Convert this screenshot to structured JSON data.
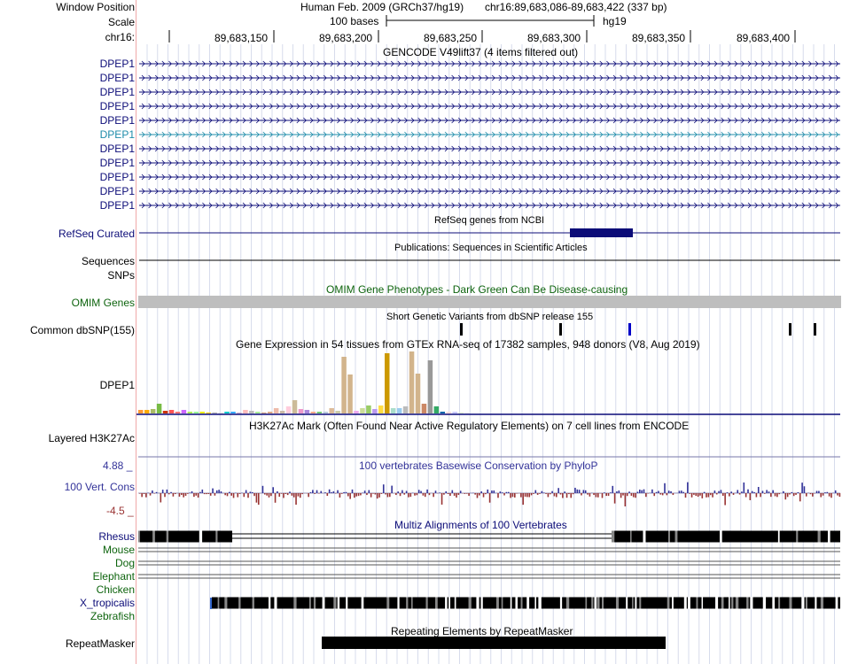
{
  "header": {
    "window_position_label": "Window Position",
    "scale_label": "Scale",
    "chrom_label": "chr16:",
    "assembly": "Human Feb. 2009 (GRCh37/hg19)",
    "position": "chr16:89,683,086-89,683,422 (337 bp)",
    "scale_text": "100 bases",
    "db": "hg19",
    "ticks": [
      "89,683,150",
      "89,683,200",
      "89,683,250",
      "89,683,300",
      "89,683,350",
      "89,683,400"
    ]
  },
  "gencode": {
    "title": "GENCODE V49lift37 (4 items filtered out)",
    "items": [
      "DPEP1",
      "DPEP1",
      "DPEP1",
      "DPEP1",
      "DPEP1",
      "DPEP1",
      "DPEP1",
      "DPEP1",
      "DPEP1",
      "DPEP1",
      "DPEP1"
    ],
    "colors": [
      "#0c0c78",
      "#0c0c78",
      "#0c0c78",
      "#0c0c78",
      "#0c0c78",
      "#1e8caa",
      "#0c0c78",
      "#0c0c78",
      "#0c0c78",
      "#0c0c78",
      "#0c0c78"
    ]
  },
  "refseq": {
    "title": "RefSeq genes from NCBI",
    "label": "RefSeq Curated",
    "color": "#0c0c78"
  },
  "pubs": {
    "title": "Publications: Sequences in Scientific Articles",
    "label": "Sequences"
  },
  "snps": {
    "label": "SNPs"
  },
  "omim": {
    "title": "OMIM Gene Phenotypes - Dark Green Can Be Disease-causing",
    "label": "OMIM Genes",
    "color": "#0e640e"
  },
  "dbsnp": {
    "title": "Short Genetic Variants from dbSNP release 155",
    "label": "Common dbSNP(155)"
  },
  "gtex": {
    "title": "Gene Expression in 54 tissues from GTEx RNA-seq of 17382 samples, 948 donors (V8, Aug 2019)",
    "label": "DPEP1",
    "values": [
      4,
      4,
      5,
      11,
      3,
      4,
      2,
      4,
      2,
      2,
      2,
      1,
      1,
      1,
      2,
      2,
      1,
      4,
      3,
      2,
      1,
      2,
      6,
      3,
      8,
      15,
      5,
      4,
      2,
      2,
      2,
      6,
      3,
      64,
      44,
      3,
      6,
      9,
      5,
      9,
      68,
      6,
      6,
      8,
      70,
      45,
      11,
      60,
      8,
      2,
      2,
      2,
      1,
      1
    ],
    "colors": [
      "#ff9933",
      "#ffaa00",
      "#aabb66",
      "#77bb44",
      "#cc3300",
      "#ff5555",
      "#ff7777",
      "#cc66ff",
      "#aaee55",
      "#99ff99",
      "#eeee00",
      "#ffcc00",
      "#aaaaaa",
      "#dddddd",
      "#00cccc",
      "#33aaff",
      "#ccaacc",
      "#ffbbbb",
      "#bbbbbb",
      "#aaee99",
      "#cc9977",
      "#ddaa88",
      "#eebbaa",
      "#ccbbaa",
      "#ffccdd",
      "#ccbb99",
      "#ee99cc",
      "#aa88dd",
      "#ffaa88",
      "#77cc77",
      "#bbccdd",
      "#ddbb99",
      "#ccccaa",
      "#d2b48c",
      "#d2b48c",
      "#eeaaee",
      "#ccdd99",
      "#99cc66",
      "#bb99ee",
      "#ffdd44",
      "#cc9900",
      "#aaddcc",
      "#99ccee",
      "#bbbbbb",
      "#d2b48c",
      "#d2b48c",
      "#cc8866",
      "#999999",
      "#33aa66",
      "#0066aa",
      "#ffdddd",
      "#ccccff",
      "#ddeecc",
      "#eeeeee"
    ]
  },
  "h3k27ac": {
    "title": "H3K27Ac Mark (Often Found Near Active Regulatory Elements) on 7 cell lines from ENCODE",
    "label": "Layered H3K27Ac"
  },
  "cons": {
    "title": "100 vertebrates Basewise Conservation by PhyloP",
    "label": "100 Vert. Cons",
    "max": "4.88 _",
    "min": "-4.5 _",
    "pos_color": "#333399",
    "neg_color": "#993333"
  },
  "multiz": {
    "title": "Multiz Alignments of 100 Vertebrates",
    "species": [
      "Rhesus",
      "Mouse",
      "Dog",
      "Elephant",
      "Chicken",
      "X_tropicalis",
      "Zebrafish"
    ],
    "colors": [
      "#0c0c78",
      "#0e640e",
      "#0e640e",
      "#0e640e",
      "#0e640e",
      "#0c0c78",
      "#0e640e"
    ]
  },
  "repeat": {
    "title": "Repeating Elements by RepeatMasker",
    "label": "RepeatMasker"
  }
}
